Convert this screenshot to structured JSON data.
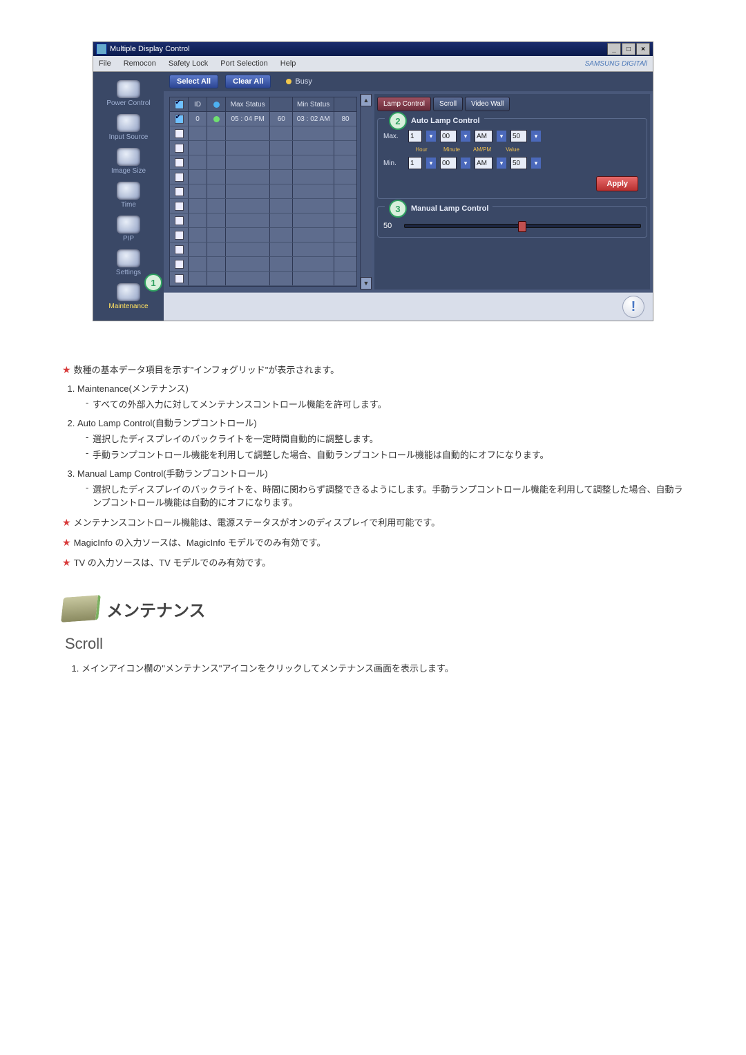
{
  "window": {
    "title": "Multiple Display Control",
    "minimize": "_",
    "restore": "□",
    "close": "×"
  },
  "menubar": {
    "file": "File",
    "remocon": "Remocon",
    "safety": "Safety Lock",
    "port": "Port Selection",
    "help": "Help",
    "brand": "SAMSUNG DIGITAll"
  },
  "sidebar": {
    "power": "Power Control",
    "input": "Input Source",
    "image": "Image Size",
    "time": "Time",
    "pip": "PIP",
    "settings": "Settings",
    "maint": "Maintenance"
  },
  "callouts": {
    "n1": "1",
    "n2": "2",
    "n3": "3"
  },
  "toolbar": {
    "select_all": "Select All",
    "clear_all": "Clear All",
    "busy": "Busy"
  },
  "grid": {
    "hdr_id": "ID",
    "hdr_max": "Max Status",
    "hdr_min": "Min Status",
    "row0": {
      "id": "0",
      "max_t": "05 : 04 PM",
      "max_v": "60",
      "min_t": "03 : 02 AM",
      "min_v": "80"
    }
  },
  "tabs": {
    "lamp": "Lamp Control",
    "scroll": "Scroll",
    "video": "Video Wall"
  },
  "auto_lamp": {
    "title": "Auto Lamp Control",
    "max": "Max.",
    "min": "Min.",
    "hour": "1",
    "minute": "00",
    "ampm": "AM",
    "value": "50",
    "lab_hour": "Hour",
    "lab_min": "Minute",
    "lab_ampm": "AM/PM",
    "lab_val": "Value",
    "apply": "Apply"
  },
  "manual_lamp": {
    "title": "Manual Lamp Control",
    "value": "50"
  },
  "alert": "!",
  "doc": {
    "star1": "数種の基本データ項目を示す\"インフォグリッド\"が表示されます。",
    "li1": "Maintenance(メンテナンス)",
    "li1a": "すべての外部入力に対してメンテナンスコントロール機能を許可します。",
    "li2": "Auto Lamp Control(自動ランプコントロール)",
    "li2a": "選択したディスプレイのバックライトを一定時間自動的に調整します。",
    "li2b": "手動ランプコントロール機能を利用して調整した場合、自動ランプコントロール機能は自動的にオフになります。",
    "li3": "Manual Lamp Control(手動ランプコントロール)",
    "li3a": "選択したディスプレイのバックライトを、時間に関わらず調整できるようにします。手動ランプコントロール機能を利用して調整した場合、自動ランプコントロール機能は自動的にオフになります。",
    "star2": "メンテナンスコントロール機能は、電源ステータスがオンのディスプレイで利用可能です。",
    "star3": "MagicInfo の入力ソースは、MagicInfo モデルでのみ有効です。",
    "star4": "TV の入力ソースは、TV モデルでのみ有効です。",
    "sec_title": "メンテナンス",
    "sub_title": "Scroll",
    "step1": "メインアイコン欄の\"メンテナンス\"アイコンをクリックしてメンテナンス画面を表示します。"
  }
}
